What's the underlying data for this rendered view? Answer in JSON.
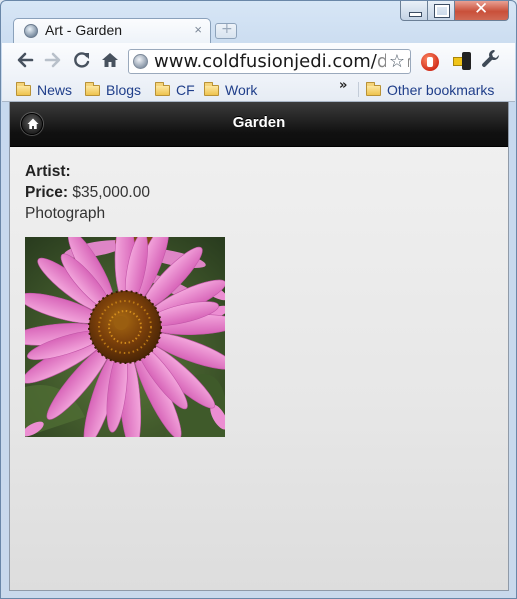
{
  "browser": {
    "tab_title": "Art - Garden",
    "tab_close": "×",
    "url_main": "www.coldfusionjedi.com/",
    "url_rest": "dem",
    "bookmarks": [
      "News",
      "Blogs",
      "CF",
      "Work"
    ],
    "bookmarks_overflow": "»",
    "other_bookmarks": "Other bookmarks",
    "window_close": "✕"
  },
  "page": {
    "header_title": "Garden",
    "artist_label": "Artist:",
    "artist_value": "",
    "price_label": "Price:",
    "price_value": "$35,000.00",
    "medium": "Photograph"
  },
  "colors": {
    "header_bar": "#111111",
    "page_bg": "#e7e7e7",
    "bookmark_text": "#1f3e8a"
  }
}
